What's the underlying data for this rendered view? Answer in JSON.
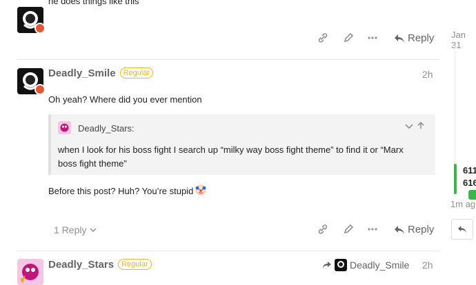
{
  "top_post": {
    "text_snippet": "he does things like this",
    "actions": {
      "reply_label": "Reply"
    }
  },
  "post": {
    "username": "Deadly_Smile",
    "flair": "Regular",
    "time": "2h",
    "body_line1": "Oh yeah? Where did you ever mention",
    "quote": {
      "author": "Deadly_Stars:",
      "text": "when I look for his boss fight I search up “milky way boss fight theme” to find it or “Marx boss fight theme”"
    },
    "body_line2": "Before this post? Huh? You’re stupid",
    "replies_label": "1 Reply",
    "reply_label": "Reply"
  },
  "next_post": {
    "username": "Deadly_Stars",
    "flair": "Regular",
    "reply_to": "Deadly_Smile",
    "time": "2h"
  },
  "timeline": {
    "top_date": "Jan 31",
    "count_line1": "611",
    "count_line2": "616",
    "bottom_date": "1m ag"
  },
  "colors": {
    "accent_green": "#3ab54a",
    "flair_yellow": "#e9b82a",
    "badge_red": "#e45735"
  }
}
